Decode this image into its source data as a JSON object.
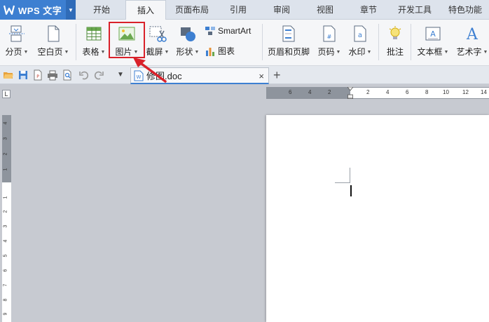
{
  "app": {
    "title": "WPS 文字"
  },
  "menu": {
    "tabs": [
      "开始",
      "插入",
      "页面布局",
      "引用",
      "审阅",
      "视图",
      "章节",
      "开发工具",
      "特色功能"
    ],
    "active_tab": "插入"
  },
  "ribbon": {
    "page_break": "分页",
    "blank_page": "空白页",
    "table": "表格",
    "picture": "图片",
    "screenshot": "截屏",
    "shapes": "形状",
    "smartart": "SmartArt",
    "chart": "图表",
    "header_footer": "页眉和页脚",
    "page_number": "页码",
    "watermark": "水印",
    "comment": "批注",
    "textbox": "文本框",
    "wordart": "艺术字"
  },
  "document_tab": {
    "name": "修图.doc",
    "close": "×",
    "new_tab": "+"
  },
  "ruler": {
    "horizontal_ticks": [
      "6",
      "4",
      "2",
      "2",
      "4",
      "6",
      "8",
      "10",
      "12",
      "14"
    ],
    "vertical_ticks": [
      "4",
      "3",
      "2",
      "1",
      "1",
      "2",
      "3",
      "4",
      "5",
      "6",
      "7",
      "8",
      "9"
    ],
    "corner": "L"
  },
  "colors": {
    "accent": "#3d7fd1",
    "highlight": "#d9212a",
    "ribbon_bg": "#f5f6f8",
    "workspace_bg": "#c7cad1"
  }
}
